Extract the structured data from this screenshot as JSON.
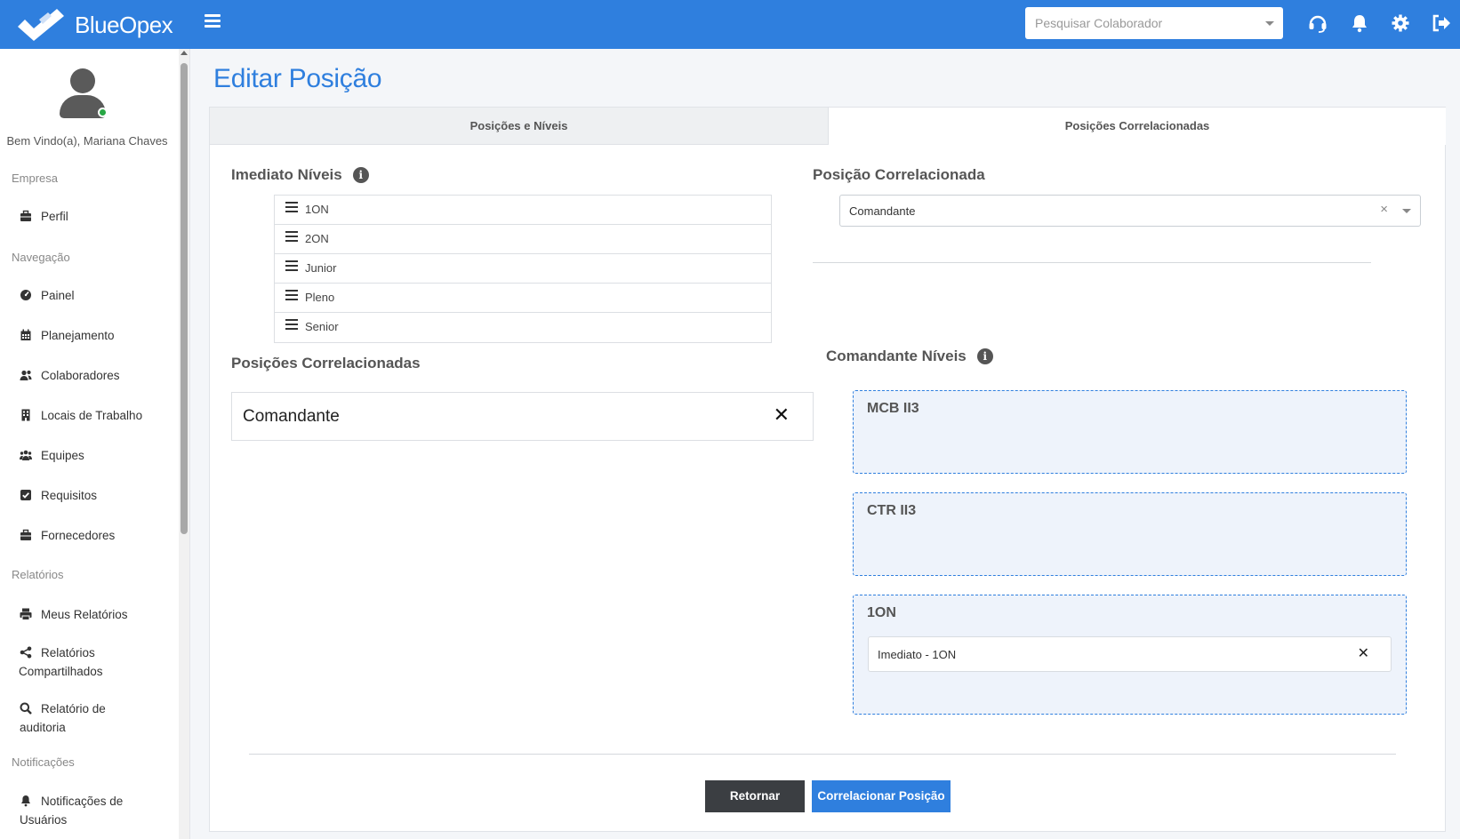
{
  "app": {
    "brand": "BlueOpex"
  },
  "header": {
    "search_placeholder": "Pesquisar Colaborador",
    "icons": [
      "headset-icon",
      "bell-icon",
      "gear-icon",
      "sign-out-icon"
    ]
  },
  "sidebar": {
    "welcome": "Bem Vindo(a), Mariana Chaves",
    "sections": {
      "empresa": "Empresa",
      "navegacao": "Navegação",
      "relatorios": "Relatórios",
      "notificacoes": "Notificações"
    },
    "items": {
      "perfil": "Perfil",
      "painel": "Painel",
      "planejamento": "Planejamento",
      "colaboradores": "Colaboradores",
      "locais": "Locais de Trabalho",
      "equipes": "Equipes",
      "requisitos": "Requisitos",
      "fornecedores": "Fornecedores",
      "meus_relatorios": "Meus Relatórios",
      "relatorios_comp_1": "Relatórios",
      "relatorios_comp_2": "Compartilhados",
      "relatorio_aud_1": "Relatório de",
      "relatorio_aud_2": "auditoria",
      "notif_1": "Notificações de",
      "notif_2": "Usuários"
    }
  },
  "page": {
    "title": "Editar Posição",
    "tabs": {
      "left": "Posições e Níveis",
      "right": "Posições Correlacionadas"
    },
    "imediato_title": "Imediato Níveis",
    "levels": [
      "1ON",
      "2ON",
      "Junior",
      "Pleno",
      "Senior"
    ],
    "correlated_title": "Posições Correlacionadas",
    "correlated_item": "Comandante",
    "select_title": "Posição Correlacionada",
    "select_value": "Comandante",
    "comandante_title": "Comandante Níveis",
    "zones": {
      "z1": "MCB II3",
      "z2": "CTR II3",
      "z3": "1ON"
    },
    "chip": "Imediato - 1ON",
    "btn_back": "Retornar",
    "btn_submit": "Correlacionar Posição"
  },
  "colors": {
    "primary": "#2f7fde",
    "dark_button": "#3b3e42",
    "online": "#28a745"
  }
}
